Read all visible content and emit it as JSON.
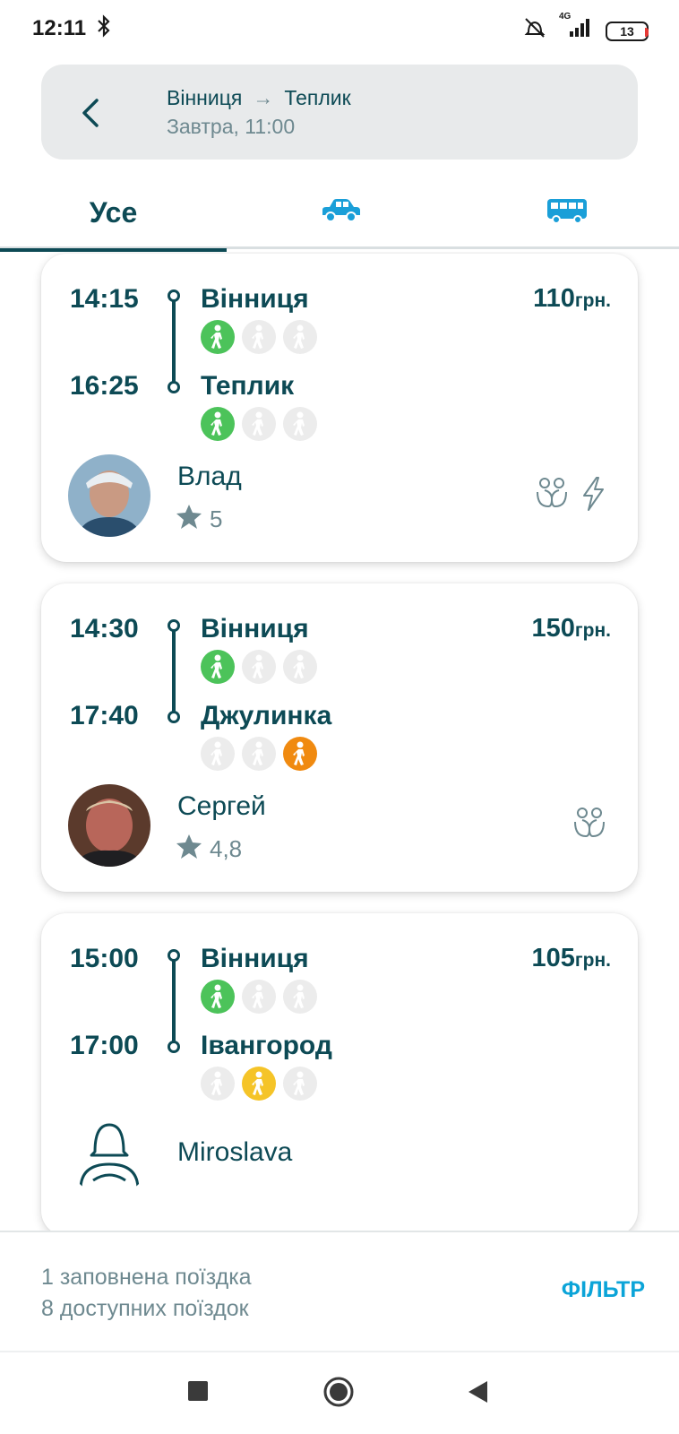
{
  "status": {
    "time": "12:11",
    "battery": "13",
    "network": "4G"
  },
  "search": {
    "from": "Вінниця",
    "to": "Теплик",
    "arrow": "→",
    "date": "Завтра, 11:00"
  },
  "tabs": {
    "all": "Усе"
  },
  "price_unit": "грн.",
  "trips": [
    {
      "depart_time": "14:15",
      "depart_city": "Вінниця",
      "arrive_time": "16:25",
      "arrive_city": "Теплик",
      "price": "110",
      "driver": "Влад",
      "rating": "5",
      "depart_seats": [
        "green",
        "free",
        "free"
      ],
      "arrive_seats": [
        "green",
        "free",
        "free"
      ],
      "features": [
        "max-2-back-icon",
        "instant-booking-icon"
      ]
    },
    {
      "depart_time": "14:30",
      "depart_city": "Вінниця",
      "arrive_time": "17:40",
      "arrive_city": "Джулинка",
      "price": "150",
      "driver": "Сергей",
      "rating": "4,8",
      "depart_seats": [
        "green",
        "free",
        "free"
      ],
      "arrive_seats": [
        "free",
        "free",
        "orange"
      ],
      "features": [
        "max-2-back-icon"
      ]
    },
    {
      "depart_time": "15:00",
      "depart_city": "Вінниця",
      "arrive_time": "17:00",
      "arrive_city": "Івангород",
      "price": "105",
      "driver": "Miroslava",
      "rating": "",
      "depart_seats": [
        "green",
        "free",
        "free"
      ],
      "arrive_seats": [
        "free",
        "yellow",
        "free"
      ],
      "features": []
    }
  ],
  "bottom": {
    "filled": "1 заповнена поїздка",
    "available": "8 доступних поїздок",
    "filter": "ФІЛЬТР"
  },
  "colors": {
    "accent": "#0d4a55",
    "link": "#0ba4d8",
    "green": "#4cc35a",
    "orange": "#f08a10",
    "yellow": "#f5c428"
  }
}
